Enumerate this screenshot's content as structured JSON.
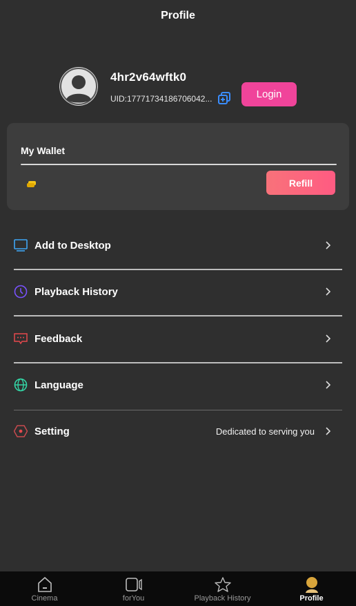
{
  "header": {
    "title": "Profile"
  },
  "profile": {
    "username": "4hr2v64wftk0",
    "uid": "UID:17771734186706042...",
    "login_label": "Login"
  },
  "wallet": {
    "title": "My Wallet",
    "refill_label": "Refill"
  },
  "menu": [
    {
      "label": "Add to Desktop",
      "icon": "monitor-icon",
      "color": "#3fa6f5"
    },
    {
      "label": "Playback History",
      "icon": "clock-icon",
      "color": "#7a52ff"
    },
    {
      "label": "Feedback",
      "icon": "feedback-icon",
      "color": "#e5484d"
    },
    {
      "label": "Language",
      "icon": "globe-icon",
      "color": "#33d6a6"
    },
    {
      "label": "Setting",
      "icon": "settings-icon",
      "color": "#e5484d",
      "extra": "Dedicated to serving you"
    }
  ],
  "tabs": [
    {
      "label": "Cinema",
      "icon": "home-icon"
    },
    {
      "label": "forYou",
      "icon": "video-icon"
    },
    {
      "label": "Playback History",
      "icon": "star-icon"
    },
    {
      "label": "Profile",
      "icon": "profile-avatar-icon",
      "active": true
    }
  ],
  "colors": {
    "accent": "#f0449a",
    "refill_start": "#f8727a",
    "refill_end": "#ff5b82",
    "background": "#2f2f2f",
    "card": "#3d3d3d"
  }
}
